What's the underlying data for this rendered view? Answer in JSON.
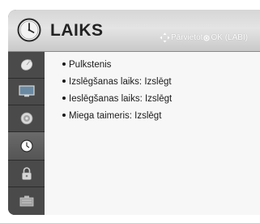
{
  "header": {
    "title": "LAIKS",
    "hint_move": "Pārvietot",
    "hint_ok": "OK (LABI)"
  },
  "sidebar": {
    "items": [
      {
        "icon": "satellite-dish-icon",
        "active": false
      },
      {
        "icon": "monitor-icon",
        "active": false
      },
      {
        "icon": "speaker-icon",
        "active": false
      },
      {
        "icon": "clock-icon",
        "active": true
      },
      {
        "icon": "lock-icon",
        "active": false
      },
      {
        "icon": "options-icon",
        "active": false
      }
    ]
  },
  "menu": {
    "items": [
      {
        "label": "Pulkstenis"
      },
      {
        "label": "Izslēgšanas laiks: Izslēgt"
      },
      {
        "label": "Ieslēgšanas laiks: Izslēgt"
      },
      {
        "label": "Miega taimeris: Izslēgt"
      }
    ]
  },
  "colors": {
    "panel_dark": "#3a3a3a",
    "content_bg": "#f7f7f7",
    "header_bg": "#dcdcdc"
  }
}
